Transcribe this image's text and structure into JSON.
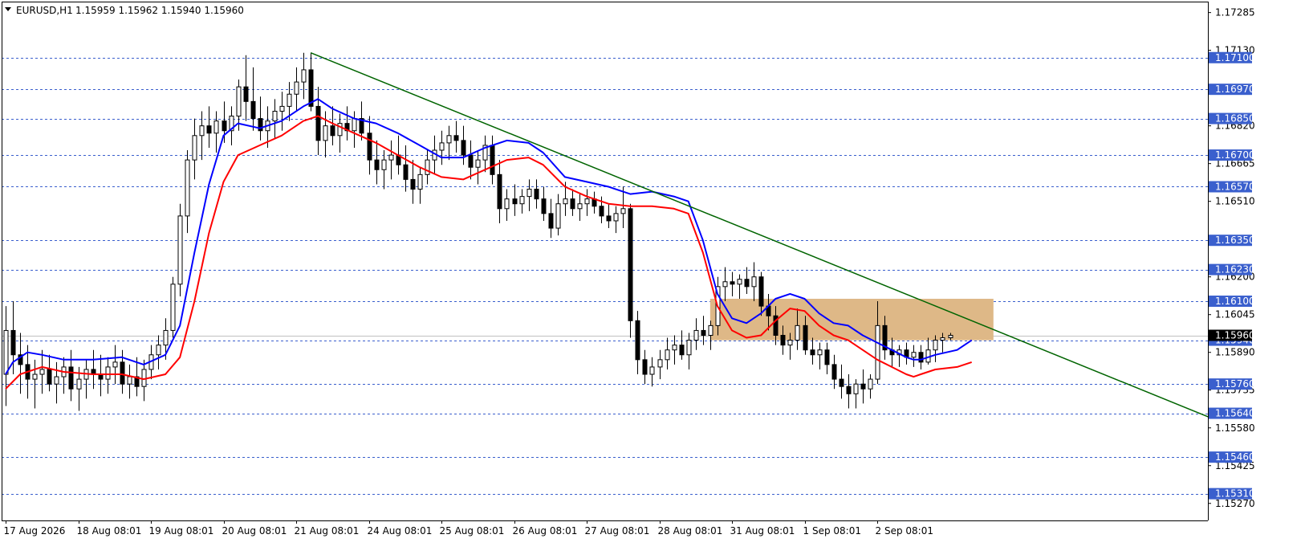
{
  "header": {
    "symbol": "EURUSD,H1",
    "ohlc": "1.15959 1.15962 1.15940 1.15960"
  },
  "chart_data": {
    "type": "candlestick",
    "title": "EURUSD,H1",
    "ylim": [
      1.152,
      1.1733
    ],
    "y_ticks": [
      "1.17285",
      "1.17130",
      "1.16820",
      "1.16665",
      "1.16510",
      "1.16200",
      "1.16045",
      "1.15890",
      "1.15735",
      "1.15580",
      "1.15425",
      "1.15270"
    ],
    "x_ticks": [
      "17 Aug 2026",
      "18 Aug 08:01",
      "19 Aug 08:01",
      "20 Aug 08:01",
      "21 Aug 08:01",
      "24 Aug 08:01",
      "25 Aug 08:01",
      "26 Aug 08:01",
      "27 Aug 08:01",
      "28 Aug 08:01",
      "31 Aug 08:01",
      "1 Sep 08:01",
      "2 Sep 08:01"
    ],
    "level_color": "#3a5fcd",
    "levels": [
      "1.17100",
      "1.16970",
      "1.16850",
      "1.16700",
      "1.16570",
      "1.16350",
      "1.16230",
      "1.16100",
      "1.15940",
      "1.15760",
      "1.15640",
      "1.15460",
      "1.15310"
    ],
    "current_price": "1.15960",
    "trendline": {
      "color": "#006400",
      "points": [
        [
          42,
          1.1712
        ],
        [
          133,
          1.1602
        ],
        [
          166,
          1.1562
        ]
      ]
    },
    "zone": {
      "x_from": 97,
      "x_to": 136,
      "y_top": 1.1611,
      "y_bottom": 1.1594,
      "color": "#deb887"
    },
    "ma_fast": {
      "color": "#0000ff",
      "points": [
        [
          0,
          1.158
        ],
        [
          1,
          1.1585
        ],
        [
          3,
          1.1589
        ],
        [
          5,
          1.1588
        ],
        [
          8,
          1.1586
        ],
        [
          12,
          1.1586
        ],
        [
          16,
          1.1587
        ],
        [
          19,
          1.1584
        ],
        [
          22,
          1.1588
        ],
        [
          24,
          1.16
        ],
        [
          26,
          1.163
        ],
        [
          28,
          1.1658
        ],
        [
          30,
          1.1678
        ],
        [
          32,
          1.1683
        ],
        [
          35,
          1.1681
        ],
        [
          38,
          1.1684
        ],
        [
          41,
          1.169
        ],
        [
          43,
          1.1693
        ],
        [
          45,
          1.1689
        ],
        [
          48,
          1.1685
        ],
        [
          51,
          1.1683
        ],
        [
          54,
          1.1679
        ],
        [
          57,
          1.1674
        ],
        [
          60,
          1.1669
        ],
        [
          63,
          1.1669
        ],
        [
          66,
          1.1673
        ],
        [
          69,
          1.1676
        ],
        [
          72,
          1.1675
        ],
        [
          74,
          1.1671
        ],
        [
          77,
          1.1661
        ],
        [
          80,
          1.1659
        ],
        [
          83,
          1.1657
        ],
        [
          86,
          1.1654
        ],
        [
          89,
          1.1655
        ],
        [
          92,
          1.1653
        ],
        [
          94,
          1.1651
        ],
        [
          96,
          1.1635
        ],
        [
          98,
          1.1613
        ],
        [
          100,
          1.1603
        ],
        [
          102,
          1.1601
        ],
        [
          104,
          1.1605
        ],
        [
          106,
          1.1611
        ],
        [
          108,
          1.1613
        ],
        [
          110,
          1.1611
        ],
        [
          112,
          1.1605
        ],
        [
          114,
          1.1601
        ],
        [
          116,
          1.16
        ],
        [
          118,
          1.1596
        ],
        [
          120,
          1.1593
        ],
        [
          122,
          1.159
        ],
        [
          124,
          1.1587
        ],
        [
          125,
          1.1586
        ],
        [
          126,
          1.1586
        ],
        [
          128,
          1.1588
        ],
        [
          131,
          1.159
        ],
        [
          133,
          1.1594
        ]
      ]
    },
    "ma_slow": {
      "color": "#ff0000",
      "points": [
        [
          0,
          1.1574
        ],
        [
          2,
          1.158
        ],
        [
          5,
          1.1583
        ],
        [
          8,
          1.1581
        ],
        [
          12,
          1.158
        ],
        [
          16,
          1.158
        ],
        [
          19,
          1.1578
        ],
        [
          22,
          1.158
        ],
        [
          24,
          1.1587
        ],
        [
          26,
          1.161
        ],
        [
          28,
          1.1638
        ],
        [
          30,
          1.1659
        ],
        [
          32,
          1.167
        ],
        [
          35,
          1.1674
        ],
        [
          38,
          1.1678
        ],
        [
          41,
          1.1684
        ],
        [
          43,
          1.1686
        ],
        [
          45,
          1.1683
        ],
        [
          48,
          1.1679
        ],
        [
          51,
          1.1675
        ],
        [
          54,
          1.167
        ],
        [
          57,
          1.1665
        ],
        [
          60,
          1.1661
        ],
        [
          63,
          1.166
        ],
        [
          66,
          1.1664
        ],
        [
          69,
          1.1668
        ],
        [
          72,
          1.1669
        ],
        [
          74,
          1.1666
        ],
        [
          77,
          1.1657
        ],
        [
          80,
          1.1653
        ],
        [
          83,
          1.165
        ],
        [
          86,
          1.1649
        ],
        [
          89,
          1.1649
        ],
        [
          92,
          1.1648
        ],
        [
          94,
          1.1646
        ],
        [
          96,
          1.163
        ],
        [
          98,
          1.1608
        ],
        [
          100,
          1.1598
        ],
        [
          102,
          1.1595
        ],
        [
          104,
          1.1596
        ],
        [
          106,
          1.1602
        ],
        [
          108,
          1.1607
        ],
        [
          110,
          1.1606
        ],
        [
          112,
          1.16
        ],
        [
          114,
          1.1596
        ],
        [
          116,
          1.1594
        ],
        [
          118,
          1.159
        ],
        [
          120,
          1.1586
        ],
        [
          122,
          1.1583
        ],
        [
          124,
          1.158
        ],
        [
          125,
          1.1579
        ],
        [
          126,
          1.158
        ],
        [
          128,
          1.1582
        ],
        [
          131,
          1.1583
        ],
        [
          133,
          1.1585
        ]
      ]
    },
    "candles": [
      [
        0,
        1.158,
        1.1608,
        1.1567,
        1.1598
      ],
      [
        1,
        1.1598,
        1.161,
        1.158,
        1.1588
      ],
      [
        2,
        1.1588,
        1.1597,
        1.1572,
        1.1584
      ],
      [
        3,
        1.1584,
        1.1592,
        1.157,
        1.1578
      ],
      [
        4,
        1.1578,
        1.1586,
        1.1566,
        1.158
      ],
      [
        5,
        1.158,
        1.159,
        1.1572,
        1.1582
      ],
      [
        6,
        1.1582,
        1.1588,
        1.1573,
        1.1576
      ],
      [
        7,
        1.1576,
        1.1585,
        1.1568,
        1.1579
      ],
      [
        8,
        1.1579,
        1.1587,
        1.1572,
        1.1583
      ],
      [
        9,
        1.1583,
        1.159,
        1.1569,
        1.1574
      ],
      [
        10,
        1.1574,
        1.1583,
        1.1565,
        1.1578
      ],
      [
        11,
        1.1578,
        1.1586,
        1.157,
        1.1582
      ],
      [
        12,
        1.1582,
        1.159,
        1.1574,
        1.158
      ],
      [
        13,
        1.158,
        1.1588,
        1.1571,
        1.1578
      ],
      [
        14,
        1.1578,
        1.1587,
        1.1572,
        1.1583
      ],
      [
        15,
        1.1583,
        1.1592,
        1.1576,
        1.1585
      ],
      [
        16,
        1.1585,
        1.159,
        1.1572,
        1.1576
      ],
      [
        17,
        1.1576,
        1.1584,
        1.157,
        1.1579
      ],
      [
        18,
        1.1579,
        1.1587,
        1.1571,
        1.1575
      ],
      [
        19,
        1.1575,
        1.1586,
        1.1569,
        1.1582
      ],
      [
        20,
        1.1582,
        1.1592,
        1.1578,
        1.1588
      ],
      [
        21,
        1.1588,
        1.1596,
        1.1582,
        1.1592
      ],
      [
        22,
        1.1592,
        1.1603,
        1.1586,
        1.1598
      ],
      [
        23,
        1.1598,
        1.162,
        1.1595,
        1.1617
      ],
      [
        24,
        1.1617,
        1.165,
        1.1612,
        1.1645
      ],
      [
        25,
        1.1645,
        1.1672,
        1.1638,
        1.1668
      ],
      [
        26,
        1.1668,
        1.1685,
        1.166,
        1.1678
      ],
      [
        27,
        1.1678,
        1.1688,
        1.1668,
        1.1682
      ],
      [
        28,
        1.1682,
        1.169,
        1.1673,
        1.1679
      ],
      [
        29,
        1.1679,
        1.1688,
        1.1671,
        1.1684
      ],
      [
        30,
        1.1684,
        1.1692,
        1.1675,
        1.168
      ],
      [
        31,
        1.168,
        1.169,
        1.1674,
        1.1686
      ],
      [
        32,
        1.1686,
        1.1701,
        1.168,
        1.1698
      ],
      [
        33,
        1.1698,
        1.1711,
        1.1684,
        1.1692
      ],
      [
        34,
        1.1692,
        1.1706,
        1.168,
        1.1685
      ],
      [
        35,
        1.1685,
        1.1694,
        1.1676,
        1.168
      ],
      [
        36,
        1.168,
        1.169,
        1.1673,
        1.1684
      ],
      [
        37,
        1.1684,
        1.1693,
        1.1677,
        1.1688
      ],
      [
        38,
        1.1688,
        1.1696,
        1.168,
        1.169
      ],
      [
        39,
        1.169,
        1.17,
        1.1684,
        1.1695
      ],
      [
        40,
        1.1695,
        1.1706,
        1.1688,
        1.17
      ],
      [
        41,
        1.17,
        1.1712,
        1.1693,
        1.1705
      ],
      [
        42,
        1.1705,
        1.1712,
        1.1688,
        1.169
      ],
      [
        43,
        1.169,
        1.1698,
        1.167,
        1.1676
      ],
      [
        44,
        1.1676,
        1.1688,
        1.1669,
        1.1682
      ],
      [
        45,
        1.1682,
        1.169,
        1.1674,
        1.1678
      ],
      [
        46,
        1.1678,
        1.1687,
        1.1671,
        1.1683
      ],
      [
        47,
        1.1683,
        1.169,
        1.1676,
        1.168
      ],
      [
        48,
        1.168,
        1.1688,
        1.1673,
        1.1685
      ],
      [
        49,
        1.1685,
        1.1692,
        1.1676,
        1.1679
      ],
      [
        50,
        1.1679,
        1.1686,
        1.1662,
        1.1668
      ],
      [
        51,
        1.1668,
        1.1676,
        1.1658,
        1.1664
      ],
      [
        52,
        1.1664,
        1.1672,
        1.1656,
        1.1668
      ],
      [
        53,
        1.1668,
        1.1676,
        1.166,
        1.167
      ],
      [
        54,
        1.167,
        1.1678,
        1.1662,
        1.1666
      ],
      [
        55,
        1.1666,
        1.1674,
        1.1655,
        1.166
      ],
      [
        56,
        1.166,
        1.1668,
        1.165,
        1.1656
      ],
      [
        57,
        1.1656,
        1.1665,
        1.165,
        1.1662
      ],
      [
        58,
        1.1662,
        1.1672,
        1.1658,
        1.1668
      ],
      [
        59,
        1.1668,
        1.1678,
        1.1662,
        1.1672
      ],
      [
        60,
        1.1672,
        1.168,
        1.1666,
        1.1675
      ],
      [
        61,
        1.1675,
        1.1682,
        1.1668,
        1.1678
      ],
      [
        62,
        1.1678,
        1.1684,
        1.1671,
        1.1676
      ],
      [
        63,
        1.1676,
        1.1682,
        1.1666,
        1.167
      ],
      [
        64,
        1.167,
        1.1676,
        1.166,
        1.1665
      ],
      [
        65,
        1.1665,
        1.1672,
        1.1658,
        1.1668
      ],
      [
        66,
        1.1668,
        1.1678,
        1.1663,
        1.1674
      ],
      [
        67,
        1.1674,
        1.1678,
        1.1658,
        1.1662
      ],
      [
        68,
        1.1662,
        1.1668,
        1.1642,
        1.1648
      ],
      [
        69,
        1.1648,
        1.1656,
        1.1643,
        1.1652
      ],
      [
        70,
        1.1652,
        1.1658,
        1.1645,
        1.165
      ],
      [
        71,
        1.165,
        1.1656,
        1.1646,
        1.1653
      ],
      [
        72,
        1.1653,
        1.166,
        1.1647,
        1.1656
      ],
      [
        73,
        1.1656,
        1.166,
        1.1648,
        1.1652
      ],
      [
        74,
        1.1652,
        1.1657,
        1.1643,
        1.1646
      ],
      [
        75,
        1.1646,
        1.1652,
        1.1636,
        1.164
      ],
      [
        76,
        1.164,
        1.1654,
        1.1637,
        1.165
      ],
      [
        77,
        1.165,
        1.1659,
        1.1645,
        1.1652
      ],
      [
        78,
        1.1652,
        1.1656,
        1.1645,
        1.1648
      ],
      [
        79,
        1.1648,
        1.1654,
        1.1643,
        1.165
      ],
      [
        80,
        1.165,
        1.1656,
        1.1645,
        1.1652
      ],
      [
        81,
        1.1652,
        1.1655,
        1.1646,
        1.1649
      ],
      [
        82,
        1.1649,
        1.1653,
        1.1642,
        1.1645
      ],
      [
        83,
        1.1645,
        1.165,
        1.164,
        1.1643
      ],
      [
        84,
        1.1643,
        1.1649,
        1.1638,
        1.1646
      ],
      [
        85,
        1.1646,
        1.1657,
        1.164,
        1.1648
      ],
      [
        86,
        1.1648,
        1.165,
        1.1595,
        1.1602
      ],
      [
        87,
        1.1602,
        1.1606,
        1.158,
        1.1586
      ],
      [
        88,
        1.1586,
        1.159,
        1.1576,
        1.158
      ],
      [
        89,
        1.158,
        1.1587,
        1.1575,
        1.1583
      ],
      [
        90,
        1.1583,
        1.159,
        1.1578,
        1.1586
      ],
      [
        91,
        1.1586,
        1.1595,
        1.1582,
        1.159
      ],
      [
        92,
        1.159,
        1.1596,
        1.1584,
        1.1592
      ],
      [
        93,
        1.1592,
        1.1598,
        1.1586,
        1.1588
      ],
      [
        94,
        1.1588,
        1.1597,
        1.1582,
        1.1594
      ],
      [
        95,
        1.1594,
        1.1603,
        1.159,
        1.1598
      ],
      [
        96,
        1.1598,
        1.1604,
        1.1592,
        1.1596
      ],
      [
        97,
        1.1596,
        1.1602,
        1.159,
        1.16
      ],
      [
        98,
        1.16,
        1.162,
        1.1596,
        1.1616
      ],
      [
        99,
        1.1616,
        1.1624,
        1.161,
        1.1618
      ],
      [
        100,
        1.1618,
        1.1622,
        1.1612,
        1.1617
      ],
      [
        101,
        1.1617,
        1.1621,
        1.1611,
        1.1619
      ],
      [
        102,
        1.1619,
        1.1624,
        1.1613,
        1.1616
      ],
      [
        103,
        1.1616,
        1.1626,
        1.161,
        1.162
      ],
      [
        104,
        1.162,
        1.1622,
        1.1604,
        1.1608
      ],
      [
        105,
        1.1608,
        1.1613,
        1.1598,
        1.1604
      ],
      [
        106,
        1.1604,
        1.1608,
        1.1592,
        1.1596
      ],
      [
        107,
        1.1596,
        1.16,
        1.1588,
        1.1592
      ],
      [
        108,
        1.1592,
        1.1597,
        1.1586,
        1.1594
      ],
      [
        109,
        1.1594,
        1.1607,
        1.159,
        1.16
      ],
      [
        110,
        1.16,
        1.1604,
        1.1588,
        1.159
      ],
      [
        111,
        1.159,
        1.1595,
        1.1584,
        1.1588
      ],
      [
        112,
        1.1588,
        1.1593,
        1.1582,
        1.159
      ],
      [
        113,
        1.159,
        1.1593,
        1.158,
        1.1584
      ],
      [
        114,
        1.1584,
        1.1588,
        1.1574,
        1.1578
      ],
      [
        115,
        1.1578,
        1.1584,
        1.157,
        1.1575
      ],
      [
        116,
        1.1575,
        1.158,
        1.1566,
        1.1572
      ],
      [
        117,
        1.1572,
        1.1578,
        1.1566,
        1.1576
      ],
      [
        118,
        1.1576,
        1.1582,
        1.1568,
        1.1574
      ],
      [
        119,
        1.1574,
        1.158,
        1.157,
        1.1578
      ],
      [
        120,
        1.1578,
        1.161,
        1.1576,
        1.16
      ],
      [
        121,
        1.16,
        1.1604,
        1.1586,
        1.159
      ],
      [
        122,
        1.159,
        1.1595,
        1.1583,
        1.1588
      ],
      [
        123,
        1.1588,
        1.1592,
        1.1583,
        1.159
      ],
      [
        124,
        1.159,
        1.1593,
        1.1584,
        1.1587
      ],
      [
        125,
        1.1587,
        1.1592,
        1.1583,
        1.1589
      ],
      [
        126,
        1.1589,
        1.1592,
        1.1582,
        1.1585
      ],
      [
        127,
        1.1585,
        1.1595,
        1.1584,
        1.159
      ],
      [
        128,
        1.159,
        1.1596,
        1.1585,
        1.1594
      ],
      [
        129,
        1.1594,
        1.1597,
        1.1589,
        1.1595
      ],
      [
        130,
        1.1595,
        1.1597,
        1.1594,
        1.1596
      ]
    ]
  }
}
